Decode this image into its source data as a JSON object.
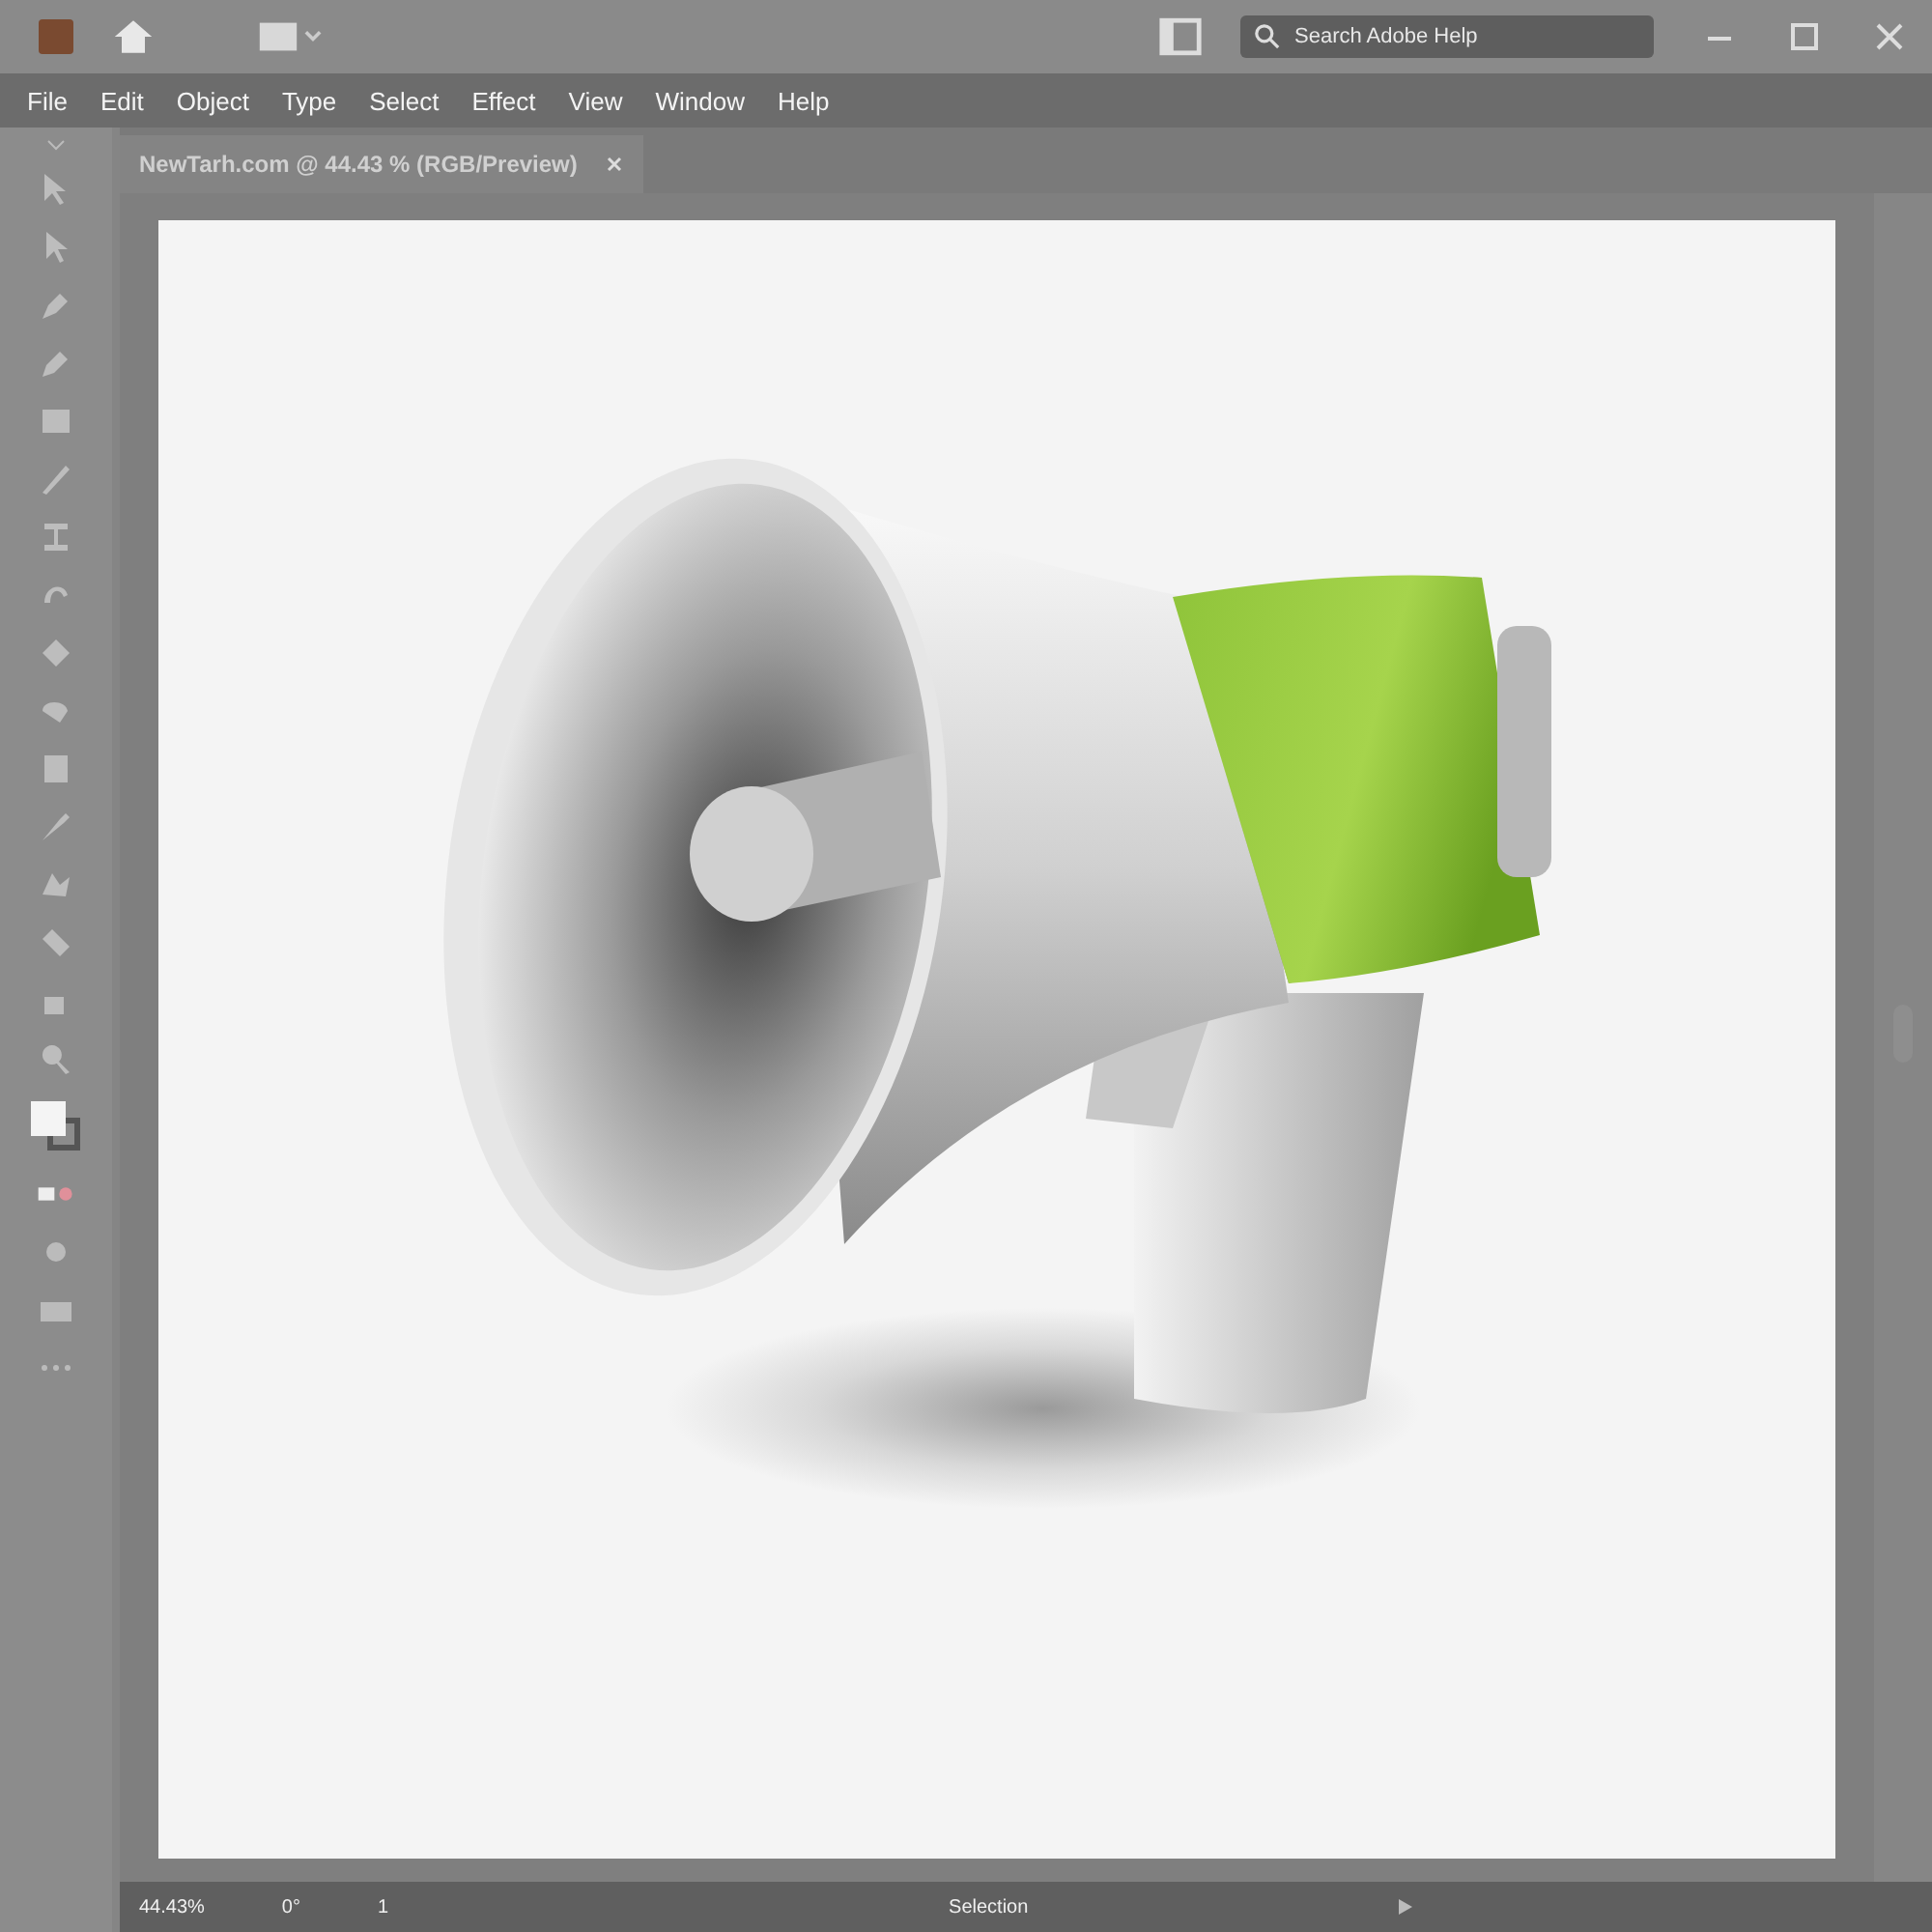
{
  "window": {
    "search": {
      "placeholder": "Search Adobe Help"
    }
  },
  "menu": [
    {
      "label": "File"
    },
    {
      "label": "Edit"
    },
    {
      "label": "Object"
    },
    {
      "label": "Type"
    },
    {
      "label": "Select"
    },
    {
      "label": "Effect"
    },
    {
      "label": "View"
    },
    {
      "label": "Window"
    },
    {
      "label": "Help"
    }
  ],
  "document_tab": {
    "title": "NewTarh.com @ 44.43 % (RGB/Preview)",
    "selected": true
  },
  "status_bar": {
    "zoom": "44.43%",
    "rotation": "0°",
    "artboard": "1",
    "tool": "Selection"
  }
}
